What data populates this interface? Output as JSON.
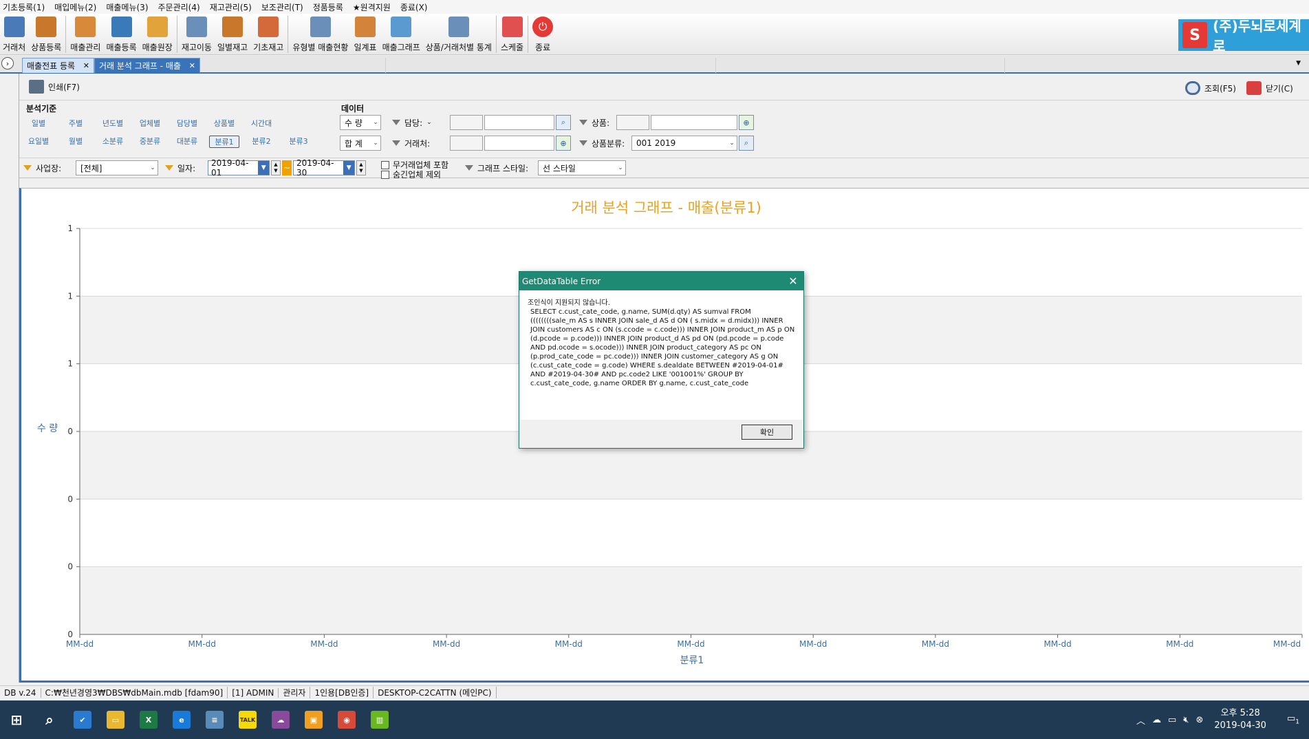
{
  "menu": [
    "기초등록(1)",
    "매입메뉴(2)",
    "매출메뉴(3)",
    "주문관리(4)",
    "재고관리(5)",
    "보조관리(T)",
    "정품등록",
    "★원격지원",
    "종료(X)"
  ],
  "toolbar": [
    {
      "label": "거래처",
      "icon": "handshake-icon",
      "color": "#4a7ab8"
    },
    {
      "label": "상품등록",
      "icon": "boxes-icon",
      "color": "#c9772a"
    },
    {
      "label": "매출관리",
      "icon": "house-icon",
      "color": "#d9893a"
    },
    {
      "label": "매출등록",
      "icon": "house-add-icon",
      "color": "#3a7ab8"
    },
    {
      "label": "매출원장",
      "icon": "ledger-icon",
      "color": "#e2a43a"
    },
    {
      "label": "재고이동",
      "icon": "list-icon",
      "color": "#6a8fb8"
    },
    {
      "label": "일별재고",
      "icon": "stock-icon",
      "color": "#c9772a"
    },
    {
      "label": "기초재고",
      "icon": "grid-icon",
      "color": "#d46a3a"
    },
    {
      "label": "유형별 매출현황",
      "icon": "report-icon",
      "color": "#6a8fb8"
    },
    {
      "label": "일계표",
      "icon": "daily-icon",
      "color": "#d4843a"
    },
    {
      "label": "매출그래프",
      "icon": "chart-icon",
      "color": "#5a9ad0"
    },
    {
      "label": "상품/거래처별 통계",
      "icon": "stats-icon",
      "color": "#6a8fb8"
    },
    {
      "label": "스케줄",
      "icon": "calendar-icon",
      "color": "#e05050"
    },
    {
      "label": "종료",
      "icon": "power-icon",
      "color": "#e53935"
    }
  ],
  "brand": {
    "logo": "S",
    "text": "(주)두뇌로세계로"
  },
  "tabs": [
    "매출전표 등록",
    "거래 분석 그래프 - 매출"
  ],
  "print_label": "인쇄(F7)",
  "query_label": "조회(F5)",
  "close_label": "닫기(C)",
  "analysis": {
    "title": "분석기준",
    "row1": [
      "일별",
      "주별",
      "년도별",
      "업체별",
      "담당별",
      "상품별",
      "시간대"
    ],
    "row2": [
      "요일별",
      "월별",
      "소분류",
      "중분류",
      "대분류",
      "분류1",
      "분류2",
      "분류3"
    ],
    "selected": "분류1"
  },
  "data_group": {
    "title": "데이터",
    "qty": "수 량",
    "total": "합 계"
  },
  "filters": {
    "manager_label": "담당:",
    "customer_label": "거래처:",
    "product_label": "상품:",
    "category_label": "상품분류:",
    "category_value": "001 2019"
  },
  "row3": {
    "site_label": "사업장:",
    "site_value": "[전체]",
    "date_label": "일자:",
    "date_from": "2019-04-01",
    "date_to": "2019-04-30",
    "check1": "무거래업체 포함",
    "check2": "숨긴업체 제외",
    "style_label": "그래프 스타일:",
    "style_value": "선 스타일"
  },
  "chart_data": {
    "type": "line",
    "title": "거래 분석 그래프 - 매출(분류1)",
    "ylabel": "수 량",
    "xlabel": "분류1",
    "y_tick_labels": [
      "1",
      "1",
      "1",
      "0",
      "0",
      "0"
    ],
    "x_tick_labels": [
      "MM-dd",
      "MM-dd",
      "MM-dd",
      "MM-dd",
      "MM-dd",
      "MM-dd",
      "MM-dd",
      "MM-dd",
      "MM-dd",
      "MM-dd",
      "MM-dd"
    ],
    "series": [],
    "grid": true
  },
  "dialog": {
    "title": "GetDataTable Error",
    "line1": "조인식이 지원되지 않습니다.",
    "sql": "SELECT c.cust_cate_code, g.name,  SUM(d.qty) AS sumval FROM ((((((((sale_m AS s INNER JOIN sale_d AS d ON ( s.midx = d.midx))) INNER JOIN customers AS c ON (s.ccode = c.code))) INNER JOIN product_m AS p ON (d.pcode = p.code))) INNER JOIN product_d AS pd ON (pd.pcode = p.code  AND pd.ocode = s.ocode))) INNER JOIN product_category AS pc ON (p.prod_cate_code = pc.code))) INNER JOIN customer_category AS g ON (c.cust_cate_code = g.code)  WHERE s.dealdate BETWEEN #2019-04-01# AND #2019-04-30# AND pc.code2 LIKE '001001%' GROUP BY c.cust_cate_code, g.name ORDER BY g.name, c.cust_cate_code",
    "ok_label": "확인"
  },
  "status": [
    "DB v.24",
    "C:₩천년경영3₩DBS₩dbMain.mdb [fdam90]",
    "[1] ADMIN",
    "관리자",
    "1인용[DB인증]",
    "DESKTOP-C2CATTN (메인PC)"
  ],
  "taskbar": {
    "apps": [
      {
        "name": "start-icon",
        "color": "#1f3a52",
        "glyph": "⊞"
      },
      {
        "name": "search-icon",
        "color": "#1f3a52",
        "glyph": "⌕"
      },
      {
        "name": "task-app-icon",
        "color": "#2a7ad0",
        "glyph": "✔"
      },
      {
        "name": "explorer-icon",
        "color": "#e8b830",
        "glyph": "▭"
      },
      {
        "name": "excel-icon",
        "color": "#1e7a45",
        "glyph": "X"
      },
      {
        "name": "edge-icon",
        "color": "#1a7ad8",
        "glyph": "e"
      },
      {
        "name": "notes-icon",
        "color": "#5a8ab8",
        "glyph": "≡"
      },
      {
        "name": "kakaotalk-icon",
        "color": "#f5d90a",
        "glyph": "TALK"
      },
      {
        "name": "cloud-app-icon",
        "color": "#8a4a9a",
        "glyph": "☁"
      },
      {
        "name": "bus-app-icon",
        "color": "#f0a020",
        "glyph": "▣"
      },
      {
        "name": "chrome-icon",
        "color": "#d64a3a",
        "glyph": "◉"
      },
      {
        "name": "green-app-icon",
        "color": "#6ab820",
        "glyph": "▥"
      }
    ],
    "time": "오후 5:28",
    "date": "2019-04-30",
    "notif": "1"
  }
}
